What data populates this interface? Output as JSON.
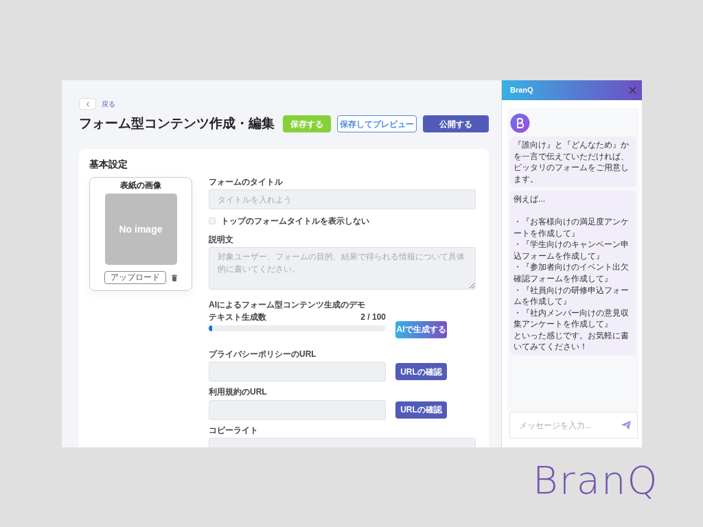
{
  "back": {
    "label": "戻る"
  },
  "page_title": "フォーム型コンテンツ作成・編集",
  "header_buttons": [
    {
      "label": "保存する",
      "kind": "success"
    },
    {
      "label": "保存してプレビュー",
      "kind": "outline"
    },
    {
      "label": "公開する",
      "kind": "primary"
    }
  ],
  "basic_settings": {
    "title": "基本設定",
    "cover": {
      "title": "表紙の画像",
      "image_text": "No image",
      "upload_button": "アップロード"
    },
    "form_title": {
      "label": "フォームのタイトル",
      "placeholder": "タイトルを入れよう"
    },
    "hide_title": {
      "label": "トップのフォームタイトルを表示しない",
      "checked": false
    },
    "description": {
      "label": "説明文",
      "placeholder": "対象ユーザー、フォームの目的、結果で得られる情報について具体的に書いてください。"
    },
    "ai_demo": {
      "title": "AIによるフォーム型コンテンツ生成のデモ",
      "counter_label": "テキスト生成数",
      "counter_value": "2 / 100",
      "level": 0.02,
      "button": "AIで生成する"
    },
    "url_fields": [
      {
        "label": "プライバシーポリシーのURL",
        "button": "URLの確認"
      },
      {
        "label": "利用規約のURL",
        "button": "URLの確認"
      }
    ],
    "copyright": {
      "label": "コピーライト"
    }
  },
  "chat": {
    "title": "BranQ",
    "messages": [
      {
        "lines": [
          "『誰向け』と『どんなため』かを一言で伝えていただければ、ピッタリのフォームをご用意します。"
        ]
      },
      {
        "lines": [
          "例えば...",
          "・『お客様向けの満足度アンケートを作成して』",
          "・『学生向けのキャンペーン申込フォームを作成して』",
          "・『参加者向けのイベント出欠確認フォームを作成して』",
          "・『社員向けの研修申込フォームを作成して』",
          "・『社内メンバー向けの意見収集アンケートを作成して』",
          "といった感じです。お気軽に書いてみてください！"
        ]
      }
    ],
    "input_placeholder": "メッセージを入力..."
  },
  "slide_logo": "BranQ"
}
